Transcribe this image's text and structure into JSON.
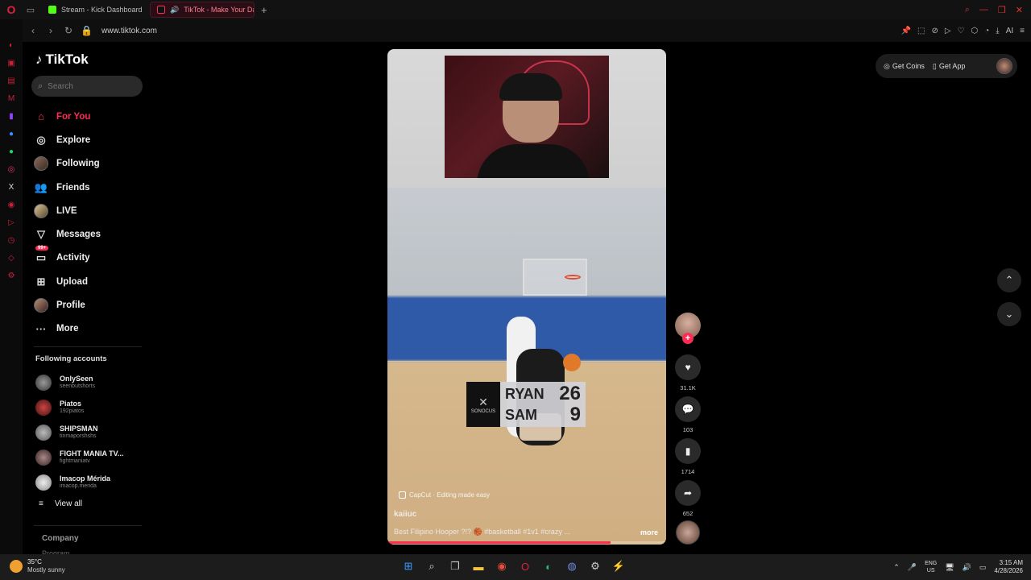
{
  "browser": {
    "tabs": [
      {
        "label": "Stream - Kick Dashboard",
        "active": false
      },
      {
        "label": "TikTok - Make Your Da",
        "active": true
      }
    ],
    "url": "www.tiktok.com",
    "ai_label": "AI"
  },
  "tiktok": {
    "logo_text": "TikTok",
    "search_placeholder": "Search",
    "nav": [
      {
        "label": "For You",
        "icon": "home-icon",
        "active": true
      },
      {
        "label": "Explore",
        "icon": "compass-icon"
      },
      {
        "label": "Following",
        "icon": "following-avatar-icon"
      },
      {
        "label": "Friends",
        "icon": "friends-icon"
      },
      {
        "label": "LIVE",
        "icon": "live-avatar-icon"
      },
      {
        "label": "Messages",
        "icon": "send-icon"
      },
      {
        "label": "Activity",
        "icon": "inbox-icon",
        "badge": "99+"
      },
      {
        "label": "Upload",
        "icon": "plus-square-icon"
      },
      {
        "label": "Profile",
        "icon": "profile-avatar-icon"
      },
      {
        "label": "More",
        "icon": "ellipsis-icon"
      }
    ],
    "following_title": "Following accounts",
    "following_accounts": [
      {
        "name": "OnlySeen",
        "handle": "seenbutshorts"
      },
      {
        "name": "Piatos",
        "handle": "192piatos"
      },
      {
        "name": "SHIPSMAN",
        "handle": "tinmaporshshs"
      },
      {
        "name": "FIGHT MANIA TV...",
        "handle": "fightmaniatv"
      },
      {
        "name": "Imacop Mérida",
        "handle": "imacop.merida"
      }
    ],
    "view_all": "View all",
    "footer": {
      "company": "Company",
      "program": "Program"
    },
    "top_right": {
      "get_coins": "Get Coins",
      "get_app": "Get App"
    },
    "video": {
      "scoreboard": {
        "logo_text": "SONOCUS",
        "rows": [
          {
            "name": "RYAN",
            "score": "26"
          },
          {
            "name": "SAM",
            "score": "9"
          }
        ]
      },
      "capcut": "CapCut · Editing made easy",
      "author": "kaiiuc",
      "description": "Best Filipino Hooper ?!? 🏀 #basketball #1v1 #crazy ...",
      "more": "more",
      "progress": 0.8
    },
    "actions": {
      "likes": "31.1K",
      "comments": "103",
      "saves": "1714",
      "shares": "652"
    }
  },
  "taskbar": {
    "weather_temp": "35°C",
    "weather_cond": "Mostly sunny",
    "lang_top": "ENG",
    "lang_bottom": "US",
    "time": "3:15 AM",
    "date": "4/28/2026"
  },
  "colors": {
    "accent": "#fe2c55",
    "opera": "#e0213e",
    "background": "#000000"
  }
}
